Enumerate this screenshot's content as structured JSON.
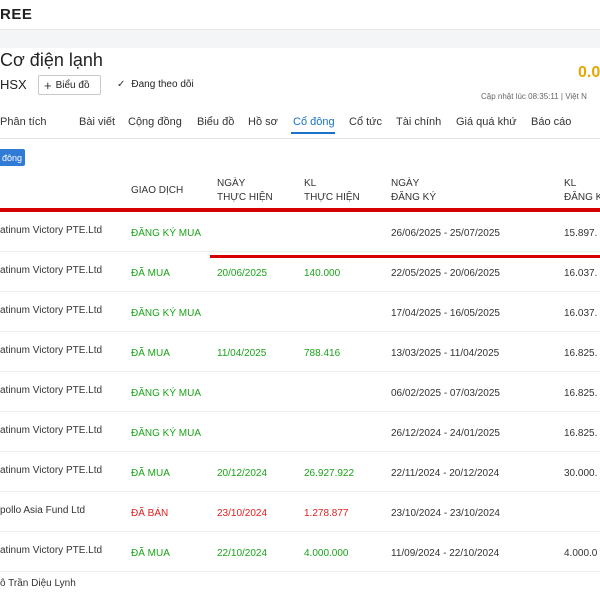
{
  "header": {
    "brand": "REE",
    "company_name": "Cơ điện lạnh",
    "price": "0.0",
    "exchange": "HSX",
    "chart_button_label": "Biểu đồ",
    "follow_label": "Đang theo dõi",
    "updated_text": "Cập nhật lúc  08:35:11 | Việt N"
  },
  "tabs": [
    {
      "label": "Phân tích"
    },
    {
      "label": "Bài viết"
    },
    {
      "label": "Cộng đồng"
    },
    {
      "label": "Biểu đồ"
    },
    {
      "label": "Hồ sơ"
    },
    {
      "label": "Cổ đông"
    },
    {
      "label": "Cổ tức"
    },
    {
      "label": "Tài chính"
    },
    {
      "label": "Giá quá khứ"
    },
    {
      "label": "Báo cáo"
    }
  ],
  "badge_label": "đông",
  "table": {
    "headers": {
      "transaction": "GIAO DỊCH",
      "exec_date_1": "NGÀY",
      "exec_date_2": "THỰC HIỆN",
      "exec_vol_1": "KL",
      "exec_vol_2": "THỰC HIỆN",
      "reg_date_1": "NGÀY",
      "reg_date_2": "ĐĂNG KÝ",
      "reg_vol_1": "KL",
      "reg_vol_2": "ĐĂNG K"
    },
    "rows": [
      {
        "name": "atinum Victory PTE.Ltd",
        "type": "ĐĂNG KÝ MUA",
        "exec_date": "",
        "exec_vol": "",
        "reg_date": "26/06/2025 - 25/07/2025",
        "reg_vol": "15.897."
      },
      {
        "name": "atinum Victory PTE.Ltd",
        "type": "ĐÃ MUA",
        "exec_date": "20/06/2025",
        "exec_vol": "140.000",
        "reg_date": "22/05/2025 - 20/06/2025",
        "reg_vol": "16.037."
      },
      {
        "name": "atinum Victory PTE.Ltd",
        "type": "ĐĂNG KÝ MUA",
        "exec_date": "",
        "exec_vol": "",
        "reg_date": "17/04/2025 - 16/05/2025",
        "reg_vol": "16.037."
      },
      {
        "name": "atinum Victory PTE.Ltd",
        "type": "ĐÃ MUA",
        "exec_date": "11/04/2025",
        "exec_vol": "788.416",
        "reg_date": "13/03/2025 - 11/04/2025",
        "reg_vol": "16.825."
      },
      {
        "name": "atinum Victory PTE.Ltd",
        "type": "ĐĂNG KÝ MUA",
        "exec_date": "",
        "exec_vol": "",
        "reg_date": "06/02/2025 - 07/03/2025",
        "reg_vol": "16.825."
      },
      {
        "name": "atinum Victory PTE.Ltd",
        "type": "ĐĂNG KÝ MUA",
        "exec_date": "",
        "exec_vol": "",
        "reg_date": "26/12/2024 - 24/01/2025",
        "reg_vol": "16.825."
      },
      {
        "name": "atinum Victory PTE.Ltd",
        "type": "ĐÃ MUA",
        "exec_date": "20/12/2024",
        "exec_vol": "26.927.922",
        "reg_date": "22/11/2024 - 20/12/2024",
        "reg_vol": "30.000."
      },
      {
        "name": "pollo Asia Fund Ltd",
        "type": "ĐÃ BÁN",
        "exec_date": "23/10/2024",
        "exec_vol": "1.278.877",
        "reg_date": "23/10/2024 - 23/10/2024",
        "reg_vol": ""
      },
      {
        "name": "atinum Victory PTE.Ltd",
        "type": "ĐÃ MUA",
        "exec_date": "22/10/2024",
        "exec_vol": "4.000.000",
        "reg_date": "11/09/2024 - 22/10/2024",
        "reg_vol": "4.000.0"
      },
      {
        "name": "ô Trần Diệu Lynh",
        "type": "",
        "exec_date": "",
        "exec_vol": "",
        "reg_date": "",
        "reg_vol": ""
      }
    ]
  },
  "colors": {
    "accent": "#1a73c8",
    "buy": "#1aa31a",
    "sell": "#e02020",
    "highlight": "#d60000",
    "price": "#e6a700"
  }
}
